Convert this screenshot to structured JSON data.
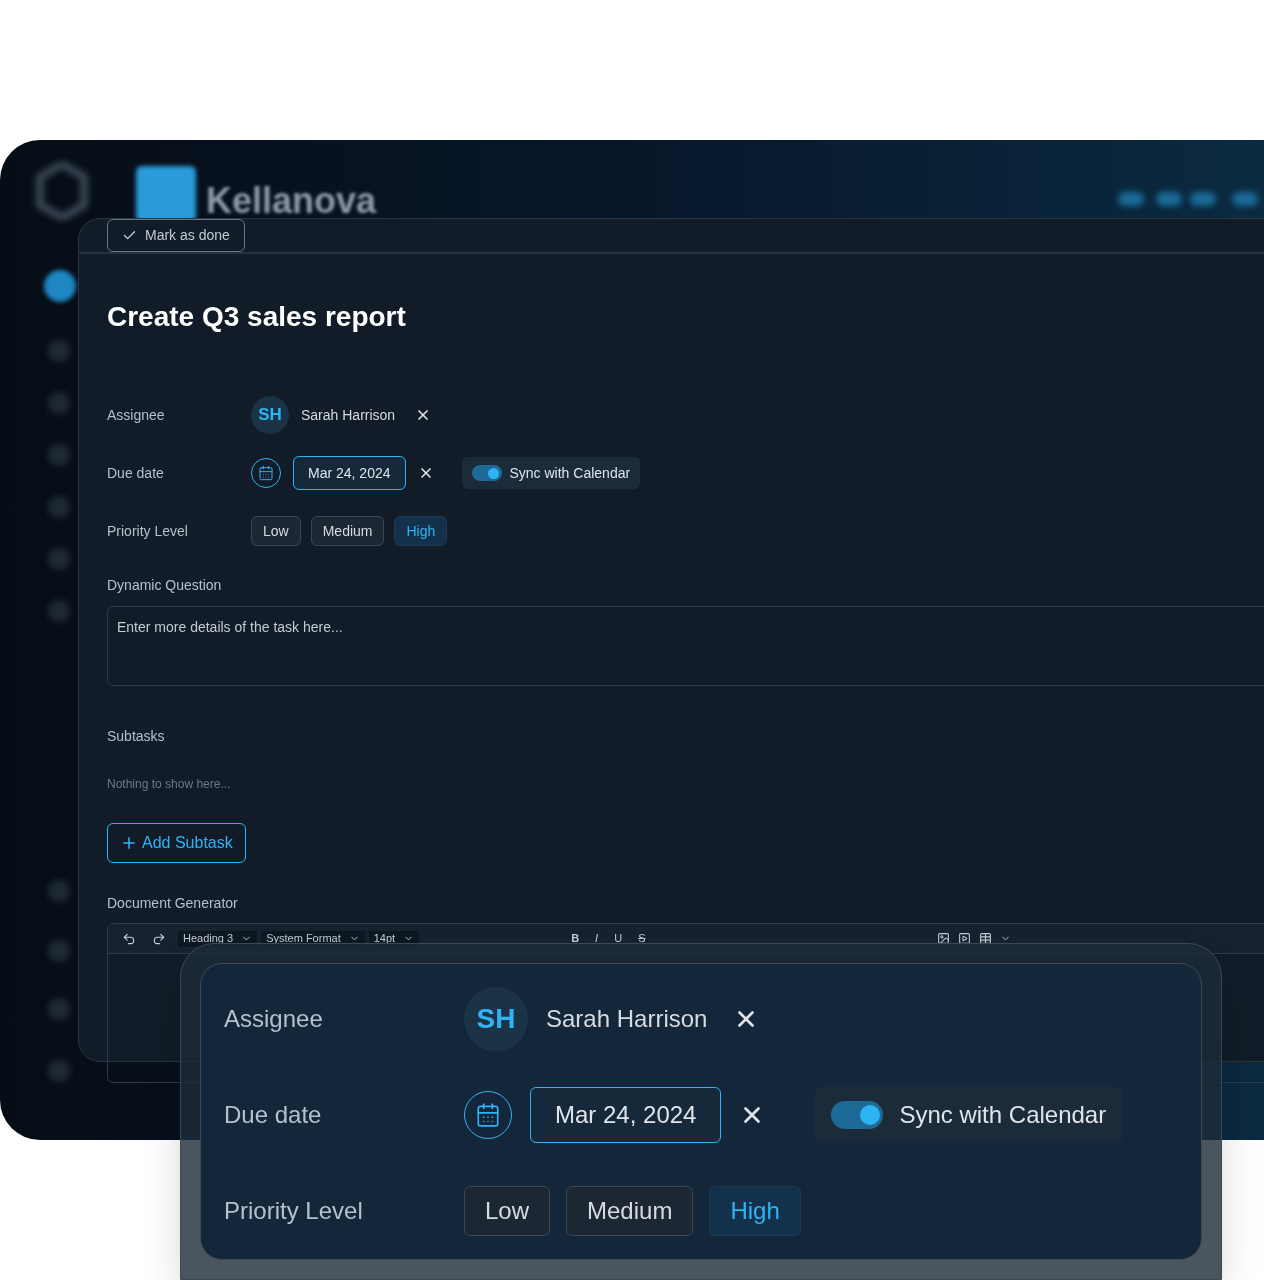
{
  "app": {
    "brand": "Kellanova"
  },
  "task": {
    "mark_done": "Mark as done",
    "title": "Create Q3 sales report",
    "fields": {
      "assignee": {
        "label": "Assignee",
        "initials": "SH",
        "name": "Sarah Harrison"
      },
      "due_date": {
        "label": "Due date",
        "value": "Mar 24, 2024",
        "sync": {
          "label": "Sync with Calendar",
          "on": true
        }
      },
      "priority": {
        "label": "Priority Level",
        "options": [
          {
            "label": "Low",
            "selected": false
          },
          {
            "label": "Medium",
            "selected": false
          },
          {
            "label": "High",
            "selected": true
          }
        ]
      }
    },
    "details": {
      "label": "Dynamic Question",
      "placeholder": "Enter more details of the task here..."
    },
    "subtasks": {
      "label": "Subtasks",
      "empty": "Nothing to show here...",
      "add": "Add Subtask"
    },
    "document": {
      "label": "Document Generator",
      "toolbar": {
        "block_style": "Heading 3",
        "font": "System Format",
        "size": "14pt",
        "format": [
          {
            "label": "B",
            "kind": "bold"
          },
          {
            "label": "I",
            "kind": "italic"
          },
          {
            "label": "U",
            "kind": "underline"
          },
          {
            "label": "S",
            "kind": "strike"
          }
        ]
      }
    }
  },
  "zoom_card": {
    "assignee": {
      "label": "Assignee",
      "initials": "SH",
      "name": "Sarah Harrison"
    },
    "due_date": {
      "label": "Due date",
      "value": "Mar 24, 2024",
      "sync": {
        "label": "Sync with Calendar",
        "on": true
      }
    },
    "priority": {
      "label": "Priority Level",
      "options": [
        {
          "label": "Low",
          "selected": false
        },
        {
          "label": "Medium",
          "selected": false
        },
        {
          "label": "High",
          "selected": true
        }
      ]
    }
  }
}
